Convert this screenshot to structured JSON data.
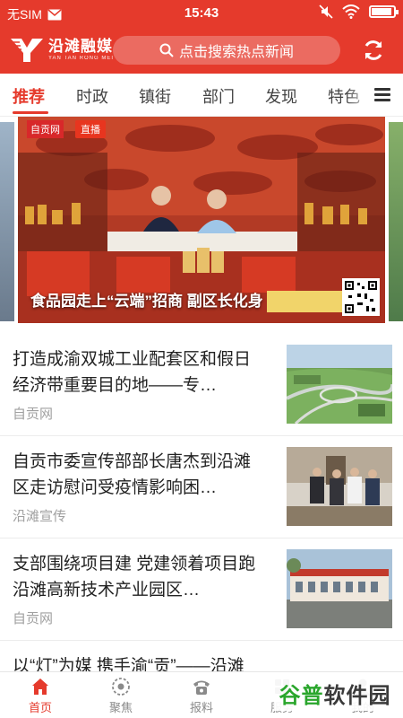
{
  "status_bar": {
    "carrier": "无SIM",
    "time": "15:43",
    "battery_level": 0.9,
    "icons": [
      "mail-icon",
      "mute-icon",
      "wifi-icon",
      "battery-icon"
    ]
  },
  "header": {
    "logo_name": "沿滩融媒",
    "logo_sub": "YAN TAN RONG MEI",
    "search_placeholder": "点击搜索热点新闻",
    "icons": [
      "search-icon",
      "refresh-icon"
    ]
  },
  "tabs": [
    {
      "label": "推荐",
      "active": true
    },
    {
      "label": "时政"
    },
    {
      "label": "镇街"
    },
    {
      "label": "部门"
    },
    {
      "label": "发现"
    },
    {
      "label": "特色"
    }
  ],
  "banner": {
    "site_badge": "自贡网",
    "live_badge": "直播",
    "caption": "食品园走上“云端”招商 副区长化身"
  },
  "news": [
    {
      "title": "打造成渝双城工业配套区和假日经济带重要目的地——专…",
      "source": "自贡网"
    },
    {
      "title": "自贡市委宣传部部长唐杰到沿滩区走访慰问受疫情影响困…",
      "source": "沿滩宣传"
    },
    {
      "title": "支部围绕项目建 党建领着项目跑 沿滩高新技术产业园区…",
      "source": "自贡网"
    },
    {
      "title": "以“灯”为媒 携手渝“贡”——沿滩",
      "source": ""
    }
  ],
  "bottom_nav": [
    {
      "label": "首页",
      "icon": "home-icon",
      "active": true
    },
    {
      "label": "聚焦",
      "icon": "focus-icon"
    },
    {
      "label": "报料",
      "icon": "phone-icon"
    },
    {
      "label": "服务",
      "icon": "service-icon"
    },
    {
      "label": "我的",
      "icon": "user-icon"
    }
  ],
  "watermark": {
    "part1": "谷普",
    "part2": "软件园"
  },
  "colors": {
    "accent": "#e53a2c",
    "text": "#222222",
    "muted": "#a0a0a0"
  }
}
